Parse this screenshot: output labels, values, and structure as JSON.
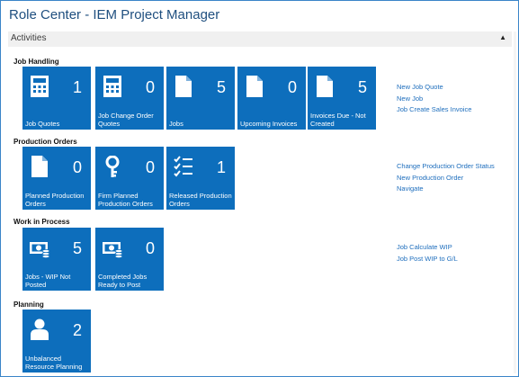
{
  "title": "Role Center - IEM Project Manager",
  "activities_label": "Activities",
  "sections": {
    "job_handling": "Job Handling",
    "production_orders": "Production Orders",
    "work_in_process": "Work in Process",
    "planning": "Planning"
  },
  "tiles": {
    "job_quotes": {
      "count": "1",
      "label": "Job Quotes"
    },
    "job_change_order_quotes": {
      "count": "0",
      "label": "Job Change Order Quotes"
    },
    "jobs": {
      "count": "5",
      "label": "Jobs"
    },
    "upcoming_invoices": {
      "count": "0",
      "label": "Upcoming Invoices"
    },
    "invoices_due": {
      "count": "5",
      "label": "Invoices Due - Not Created"
    },
    "planned_production_orders": {
      "count": "0",
      "label": "Planned Production Orders"
    },
    "firm_planned_production_orders": {
      "count": "0",
      "label": "Firm Planned Production Orders"
    },
    "released_production_orders": {
      "count": "1",
      "label": "Released Production Orders"
    },
    "jobs_wip_not_posted": {
      "count": "5",
      "label": "Jobs - WIP Not Posted"
    },
    "completed_jobs_ready": {
      "count": "0",
      "label": "Completed Jobs Ready to Post"
    },
    "unbalanced_resource_planning": {
      "count": "2",
      "label": "Unbalanced Resource Planning"
    }
  },
  "links": {
    "job_handling": [
      "New Job Quote",
      "New Job",
      "Job Create Sales Invoice"
    ],
    "production_orders": [
      "Change Production Order Status",
      "New Production Order",
      "Navigate"
    ],
    "work_in_process": [
      "Job Calculate WIP",
      "Job Post WIP to G/L"
    ]
  },
  "colors": {
    "tile": "#0d6ebc",
    "link": "#1e6ebd",
    "title": "#1f4f7f"
  }
}
